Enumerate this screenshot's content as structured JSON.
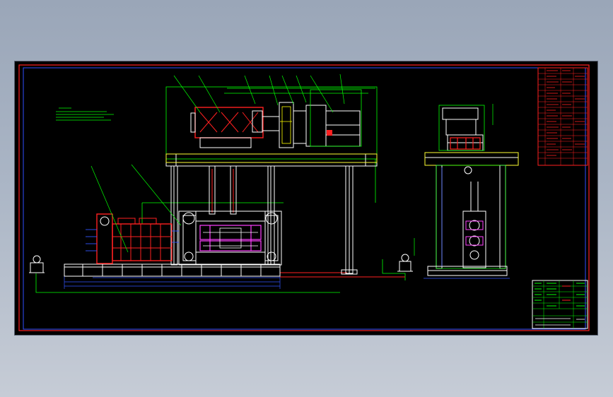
{
  "colors": {
    "background": "#000000",
    "frame": "#ff2020",
    "inner_frame": "#3050ff",
    "structure": "#ffffff",
    "outline": "#00ff00",
    "motor": "#ff2020",
    "roller": "#ff40ff",
    "dimension": "#3355ff",
    "hidden": "#ffff00",
    "table_text": "#00ff00",
    "table_red": "#ff2020"
  },
  "icons": {
    "motor": "motor-block-icon",
    "chock": "bearing-chock-icon"
  }
}
